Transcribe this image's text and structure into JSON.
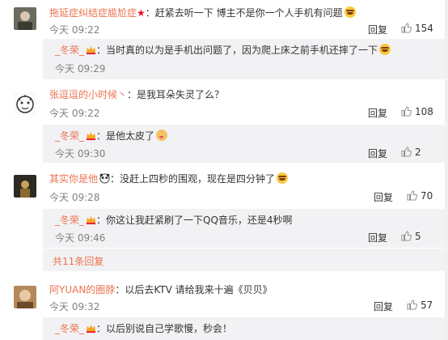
{
  "comments": [
    {
      "user": "拖延症纠结症尴尬症",
      "has_star": true,
      "text": "：赶紧去听一下 博主不是你一个人手机有问题",
      "time": "今天 09:22",
      "reply_label": "回复",
      "likes": "154",
      "sub": [
        {
          "user": "_冬荣_",
          "text": "：当时真的以为是手机出问题了，因为爬上床之前手机还摔了一下",
          "emoji": "laugh",
          "time": "今天 09:29",
          "reply_label": "",
          "likes": ""
        }
      ]
    },
    {
      "user": "张逗逗的小时候丶",
      "has_star": false,
      "text": "：是我耳朵失灵了么？",
      "time": "今天 09:22",
      "reply_label": "回复",
      "likes": "108",
      "sub": [
        {
          "user": "_冬荣_",
          "text": "：是他太皮了",
          "emoji": "naughty",
          "time": "今天 09:30",
          "reply_label": "回复",
          "likes": "2"
        }
      ]
    },
    {
      "user": "其实你是他",
      "has_star": false,
      "text": "：没赶上四秒的围观，现在是四分钟了",
      "time": "今天 09:28",
      "reply_label": "回复",
      "likes": "70",
      "sub": [
        {
          "user": "_冬荣_",
          "text": "：你这让我赶紧刷了一下QQ音乐，还是4秒啊",
          "emoji": "",
          "time": "今天 09:46",
          "reply_label": "回复",
          "likes": "5"
        }
      ],
      "more": "共11条回复"
    },
    {
      "user": "阿YUAN的圈脖",
      "has_star": false,
      "text": "：以后去KTV  请给我来十遍《贝贝》",
      "time": "今天 09:32",
      "reply_label": "回复",
      "likes": "57",
      "sub": [
        {
          "user": "_冬荣_",
          "text": "：以后别说自己学歌慢，秒会！",
          "emoji": "",
          "time": "",
          "reply_label": "",
          "likes": ""
        }
      ]
    }
  ],
  "colors": {
    "username": "#eb7350",
    "reply_bg": "#f2f2f5",
    "meta": "#808080"
  }
}
